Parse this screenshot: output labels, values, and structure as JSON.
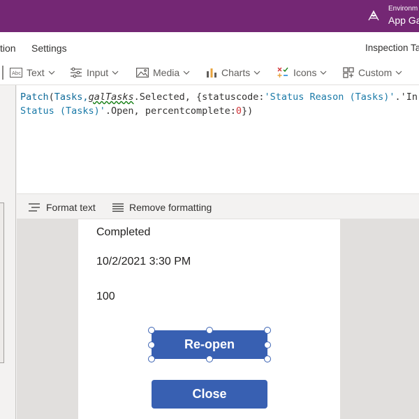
{
  "header": {
    "environment_label": "Environm",
    "environment_name": "App Ga"
  },
  "menu": {
    "items": [
      "tion",
      "Settings"
    ],
    "right_tab": "Inspection Ta"
  },
  "toolbar": {
    "text": "Text",
    "input": "Input",
    "media": "Media",
    "charts": "Charts",
    "icons": "Icons",
    "custom": "Custom"
  },
  "formula": {
    "line1": {
      "fn": "Patch",
      "open": "(",
      "arg1": "Tasks,",
      "gal": "galTasks",
      "rest": ".Selected, {statuscode:",
      "str1": "'Status Reason (Tasks)'",
      "tail": ".'In"
    },
    "line2": {
      "str": "Status (Tasks)'",
      "mid": ".Open, percentcomplete:",
      "num": "0",
      "close": "})"
    }
  },
  "format_bar": {
    "format_text": "Format text",
    "remove_formatting": "Remove formatting"
  },
  "screen": {
    "status": "Completed",
    "date": "10/2/2021 3:30 PM",
    "percent": "100",
    "reopen_button": "Re-open",
    "close_button": "Close"
  },
  "colors": {
    "top_bar": "#742774",
    "button": "#3860b2"
  }
}
